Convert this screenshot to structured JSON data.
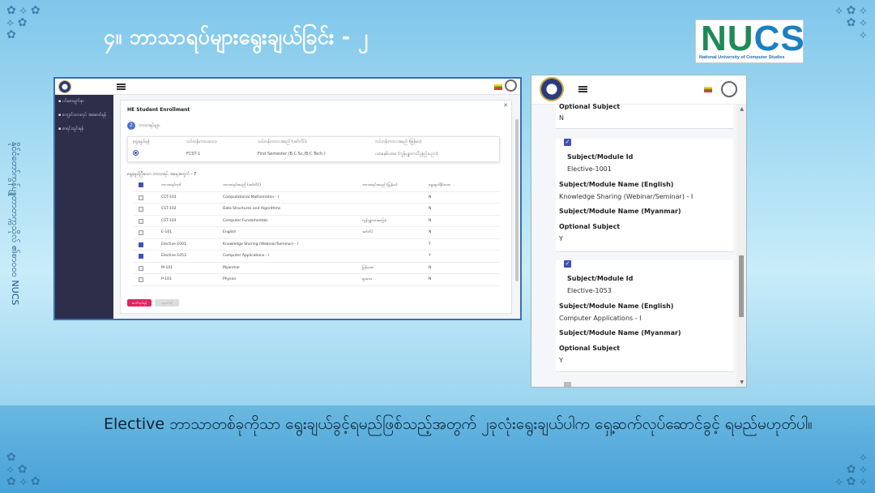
{
  "slide": {
    "title": "၄။ ဘာသာရပ်များရွေးချယ်ခြင်း - ၂",
    "logo_big": "NUCS",
    "logo_small": "National University of Computer Studies",
    "side_text": "နိုင်ငံတော်ကွန်ပျူတာတက္ကသိုလ် ၏စာဝ၀၀ NUCS",
    "caption": "Elective ဘာသာတစ်ခုကိုသာ ရွေးချယ်ခွင့်ရမည်ဖြစ်သည့်အတွက် ၂ခုလုံးရွေးချယ်ပါက ရှေ့ဆက်လုပ်ဆောင်ခွင့် ရမည်မဟုတ်ပါ။"
  },
  "enroll_screen": {
    "nav_items": [
      "ပင်မစာမျက်နှာ",
      "ကျောင်းသားလုပ် အဆောင်ရန်",
      "စာရင်းသွင်းရန်"
    ],
    "heading": "HE Student Enrollment",
    "step_number": "2",
    "step_label": "ဘာသာရပ်များ",
    "semester_headers": [
      "ရွေးချယ်ရန်",
      "သင်တန်းကာလဒေသ",
      "သင်တန်းကာလအမည် (အင်္ဂလိပ်)",
      "သင်တန်းကာလအမည် (မြန်မာ)"
    ],
    "semester_row": [
      "",
      "FCST-1",
      "First Semester (B.C.Sc./B.C.Tech.)",
      "ပထမနှစ်ပထမ (ကွန်ပျူတာသိပ္ပံနည်းပညာ)"
    ],
    "subjects_note": "ရွေးချယ်ပြီးသော ဘာသာရပ် အရေအတွက် - 7",
    "table_headers": [
      "ဘာသာရပ်ကုဒ်",
      "ဘာသာရပ်အမည် (အင်္ဂလိပ်)",
      "ဘာသာရပ်အမည် (မြန်မာ)",
      "ရွေးချယ်နိုင်သော"
    ],
    "rows": [
      {
        "code": "CCT-101",
        "en": "Computational Mathematics - I",
        "mm": "",
        "opt": "N",
        "checked": false
      },
      {
        "code": "CST-102",
        "en": "Data Structures and Algorithms",
        "mm": "",
        "opt": "N",
        "checked": false
      },
      {
        "code": "CST-103",
        "en": "Computer Fundamentals",
        "mm": "ကွန်ပျူတာအခြေခံ",
        "opt": "N",
        "checked": false
      },
      {
        "code": "E-101",
        "en": "English",
        "mm": "အင်္ဂလိပ်",
        "opt": "N",
        "checked": false
      },
      {
        "code": "Elective-1001",
        "en": "Knowledge Sharing (Webinar/Seminar) - I",
        "mm": "",
        "opt": "Y",
        "checked": true
      },
      {
        "code": "Elective-1053",
        "en": "Computer Applications - I",
        "mm": "",
        "opt": "Y",
        "checked": true
      },
      {
        "code": "M-101",
        "en": "Myanmar",
        "mm": "မြန်မာစာ",
        "opt": "N",
        "checked": false
      },
      {
        "code": "P-101",
        "en": "Physics",
        "mm": "ရူပဗေဒ",
        "opt": "N",
        "checked": false
      }
    ],
    "btn_primary": "ဆက်လုပ်ရန်",
    "btn_secondary": "နောက်သို့"
  },
  "mobile_screen": {
    "top_section": {
      "label": "Optional Subject",
      "value": "N"
    },
    "cards": [
      {
        "id_label": "Subject/Module Id",
        "id_value": "Elective-1001",
        "en_label": "Subject/Module Name (English)",
        "en_value": "Knowledge Sharing (Webinar/Seminar) - I",
        "mm_label": "Subject/Module Name (Myanmar)",
        "opt_label": "Optional Subject",
        "opt_value": "Y"
      },
      {
        "id_label": "Subject/Module Id",
        "id_value": "Elective-1053",
        "en_label": "Subject/Module Name (English)",
        "en_value": "Computer Applications - I",
        "mm_label": "Subject/Module Name (Myanmar)",
        "opt_label": "Optional Subject",
        "opt_value": "Y"
      }
    ]
  }
}
